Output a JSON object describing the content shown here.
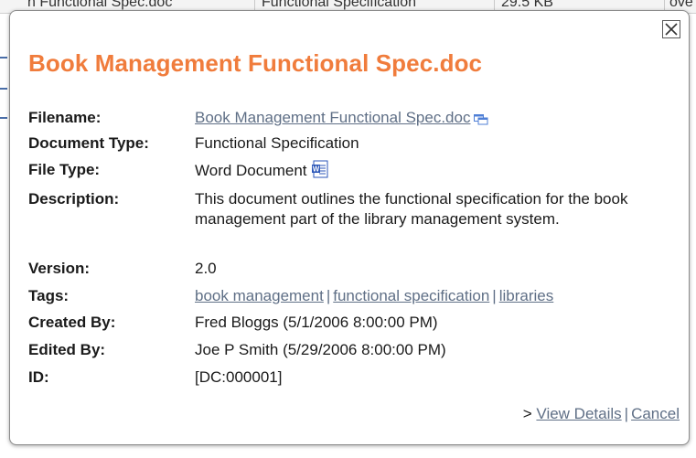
{
  "background": {
    "cells": [
      "n Functional Spec.doc",
      "Functional Specification",
      "29.5 KB",
      "ove"
    ]
  },
  "dialog": {
    "title": "Book Management Functional Spec.doc",
    "fields": {
      "filename": {
        "label": "Filename:",
        "value": "Book Management Functional Spec.doc",
        "icon": "open-window-icon"
      },
      "document_type": {
        "label": "Document Type:",
        "value": "Functional Specification"
      },
      "file_type": {
        "label": "File Type:",
        "value": "Word Document",
        "icon": "word-document-icon"
      },
      "description": {
        "label": "Description:",
        "value": "This document outlines the functional specification for the book management part of the library management system."
      },
      "version": {
        "label": "Version:",
        "value": "2.0"
      },
      "tags": {
        "label": "Tags:",
        "values": [
          "book management",
          "functional specification",
          "libraries"
        ],
        "separator": "|"
      },
      "created_by": {
        "label": "Created By:",
        "value": "Fred Bloggs (5/1/2006 8:00:00 PM)"
      },
      "edited_by": {
        "label": "Edited By:",
        "value": "Joe P Smith (5/29/2006 8:00:00 PM)"
      },
      "id": {
        "label": "ID:",
        "value": "[DC:000001]"
      }
    },
    "footer": {
      "prefix": ">",
      "view_details": "View Details",
      "separator": "|",
      "cancel": "Cancel"
    }
  },
  "colors": {
    "title": "#f07c3c",
    "link": "#5f6f86",
    "text": "#1a1a1a"
  }
}
